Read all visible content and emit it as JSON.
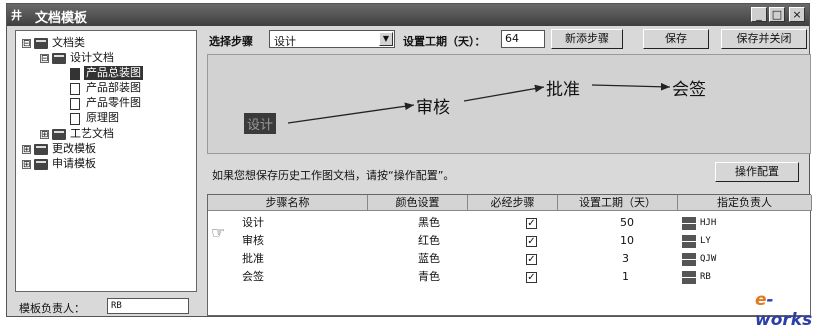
{
  "window": {
    "app_icon_text": "井",
    "title": "文档模板",
    "controls": [
      "_",
      "□",
      "×"
    ]
  },
  "tree": {
    "nodes": [
      {
        "label": "文档类",
        "expander": "⊟"
      },
      {
        "label": "设计文档",
        "expander": "⊟"
      },
      {
        "label": "产品总装图"
      },
      {
        "label": "产品部装图"
      },
      {
        "label": "产品零件图"
      },
      {
        "label": "原理图"
      },
      {
        "label": "工艺文档",
        "expander": "⊞"
      },
      {
        "label": "更改模板",
        "expander": "⊞"
      },
      {
        "label": "申请模板",
        "expander": "⊞"
      }
    ]
  },
  "footer": {
    "owner_label": "模板负责人：",
    "owner_value": "RB"
  },
  "toolbar": {
    "select_step_label": "选择步骤",
    "select_step_value": "设计",
    "set_days_label": "设置工期（天）：",
    "set_days_value": "64",
    "add_step": "新添步骤",
    "save": "保存",
    "save_close": "保存并关闭"
  },
  "flow": {
    "steps": [
      "设计",
      "审核",
      "批准",
      "会签"
    ]
  },
  "hint": {
    "text": "如果您想保存历史工作图文档，请按“操作配置”。",
    "button": "操作配置"
  },
  "table": {
    "headers": [
      "步骤名称",
      "颜色设置",
      "必经步骤",
      "设置工期（天）",
      "指定负责人"
    ],
    "rows": [
      {
        "name": "设计",
        "color": "黑色",
        "required": true,
        "days": "50",
        "owner": "HJH"
      },
      {
        "name": "审核",
        "color": "红色",
        "required": true,
        "days": "10",
        "owner": "LY"
      },
      {
        "name": "批准",
        "color": "蓝色",
        "required": true,
        "days": "3",
        "owner": "QJW"
      },
      {
        "name": "会签",
        "color": "青色",
        "required": true,
        "days": "1",
        "owner": "RB"
      }
    ]
  },
  "watermark": {
    "prefix": "e",
    "rest": "-works"
  }
}
